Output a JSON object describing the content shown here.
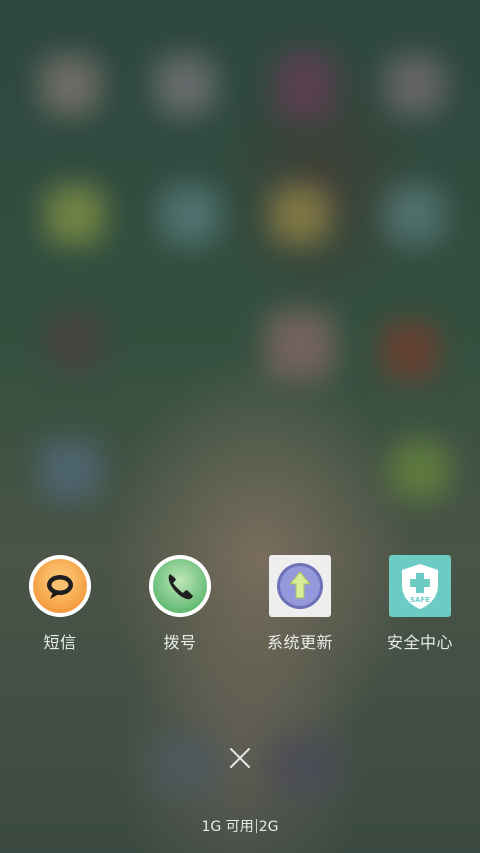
{
  "recent_apps": [
    {
      "label": "短信",
      "icon": "message-bubble-icon",
      "color": "#f7a24a"
    },
    {
      "label": "拨号",
      "icon": "phone-icon",
      "color": "#6bbd7e"
    },
    {
      "label": "系统更新",
      "icon": "system-update-arrow-icon",
      "color": "#8c8fd6"
    },
    {
      "label": "安全中心",
      "icon": "shield-plus-icon",
      "color": "#6ccbc3",
      "icon_text": "SAFE"
    }
  ],
  "close_icon": "close-icon",
  "storage": {
    "available": "1G 可用",
    "total": "2G"
  }
}
